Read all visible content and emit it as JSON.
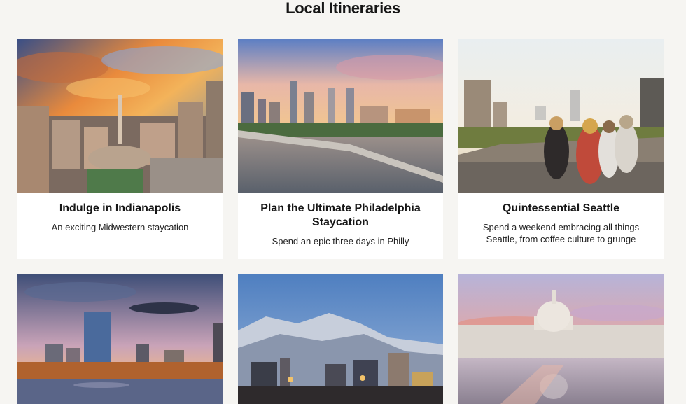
{
  "section": {
    "title": "Local Itineraries"
  },
  "cards": [
    {
      "title": "Indulge in Indianapolis",
      "description": "An exciting Midwestern staycation",
      "image": "indianapolis-skyline-sunset-photo"
    },
    {
      "title": "Plan the Ultimate Philadelphia Staycation",
      "description": "Spend an epic three days in Philly",
      "image": "philadelphia-skyline-river-photo"
    },
    {
      "title": "Quintessential Seattle",
      "description": "Spend a weekend embracing all things Seattle, from coffee culture to grunge",
      "image": "seattle-rooftop-friends-photo"
    },
    {
      "title": "",
      "description": "",
      "image": "boston-skyline-river-photo"
    },
    {
      "title": "",
      "description": "",
      "image": "salt-lake-city-mountains-photo"
    },
    {
      "title": "",
      "description": "",
      "image": "us-capitol-reflecting-pool-photo"
    }
  ]
}
